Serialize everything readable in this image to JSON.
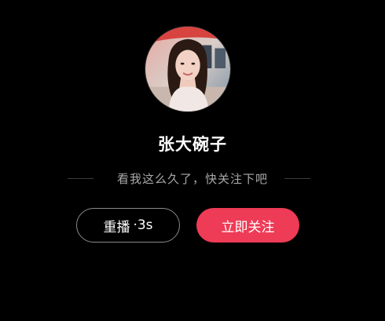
{
  "profile": {
    "name": "张大碗子",
    "avatar_icon": "user-avatar-photo"
  },
  "message": {
    "text": "看我这么久了，快关注下吧"
  },
  "actions": {
    "replay_label": "重播",
    "replay_countdown": "·3s",
    "follow_label": "立即关注"
  },
  "colors": {
    "background": "#000000",
    "follow_button": "#ee3b56",
    "subtitle_text": "#a9a9a9",
    "replay_border": "#8a8a8a"
  }
}
